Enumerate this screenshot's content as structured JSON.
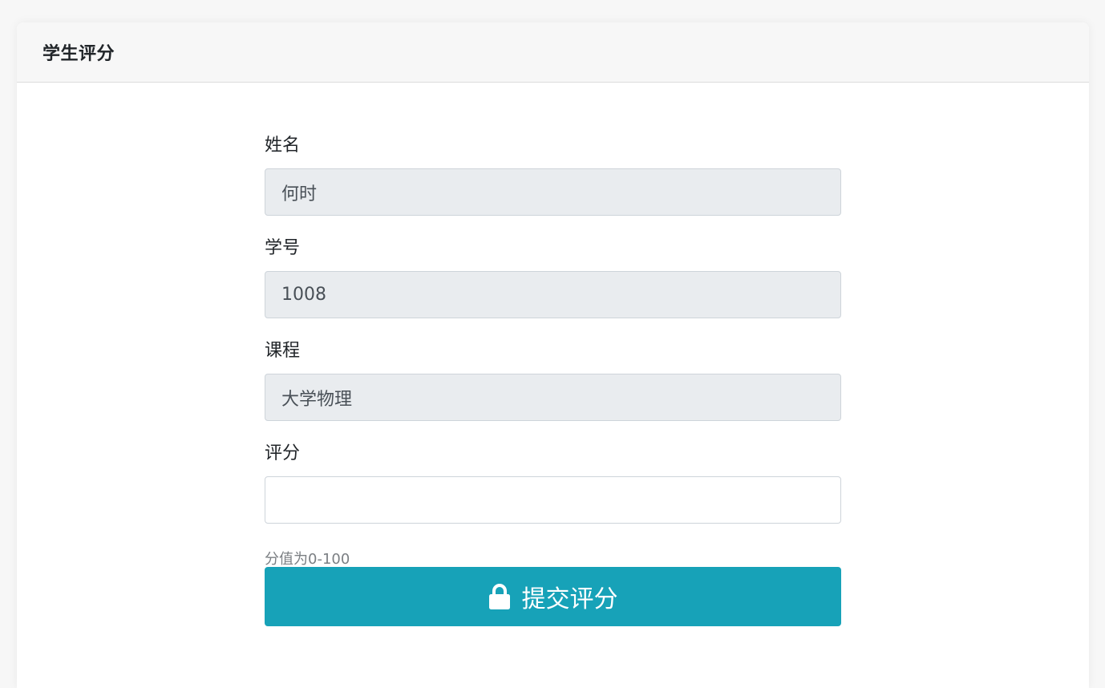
{
  "card": {
    "title": "学生评分"
  },
  "form": {
    "name": {
      "label": "姓名",
      "value": "何时"
    },
    "student_id": {
      "label": "学号",
      "value": "1008"
    },
    "course": {
      "label": "课程",
      "value": "大学物理"
    },
    "score": {
      "label": "评分",
      "value": "",
      "placeholder": ""
    },
    "help_text": "分值为0-100",
    "submit": {
      "label": "提交评分",
      "icon": "lock-icon"
    }
  },
  "colors": {
    "accent": "#17a2b8",
    "readonly_bg": "#e9ecef",
    "header_bg": "#f7f7f7"
  }
}
